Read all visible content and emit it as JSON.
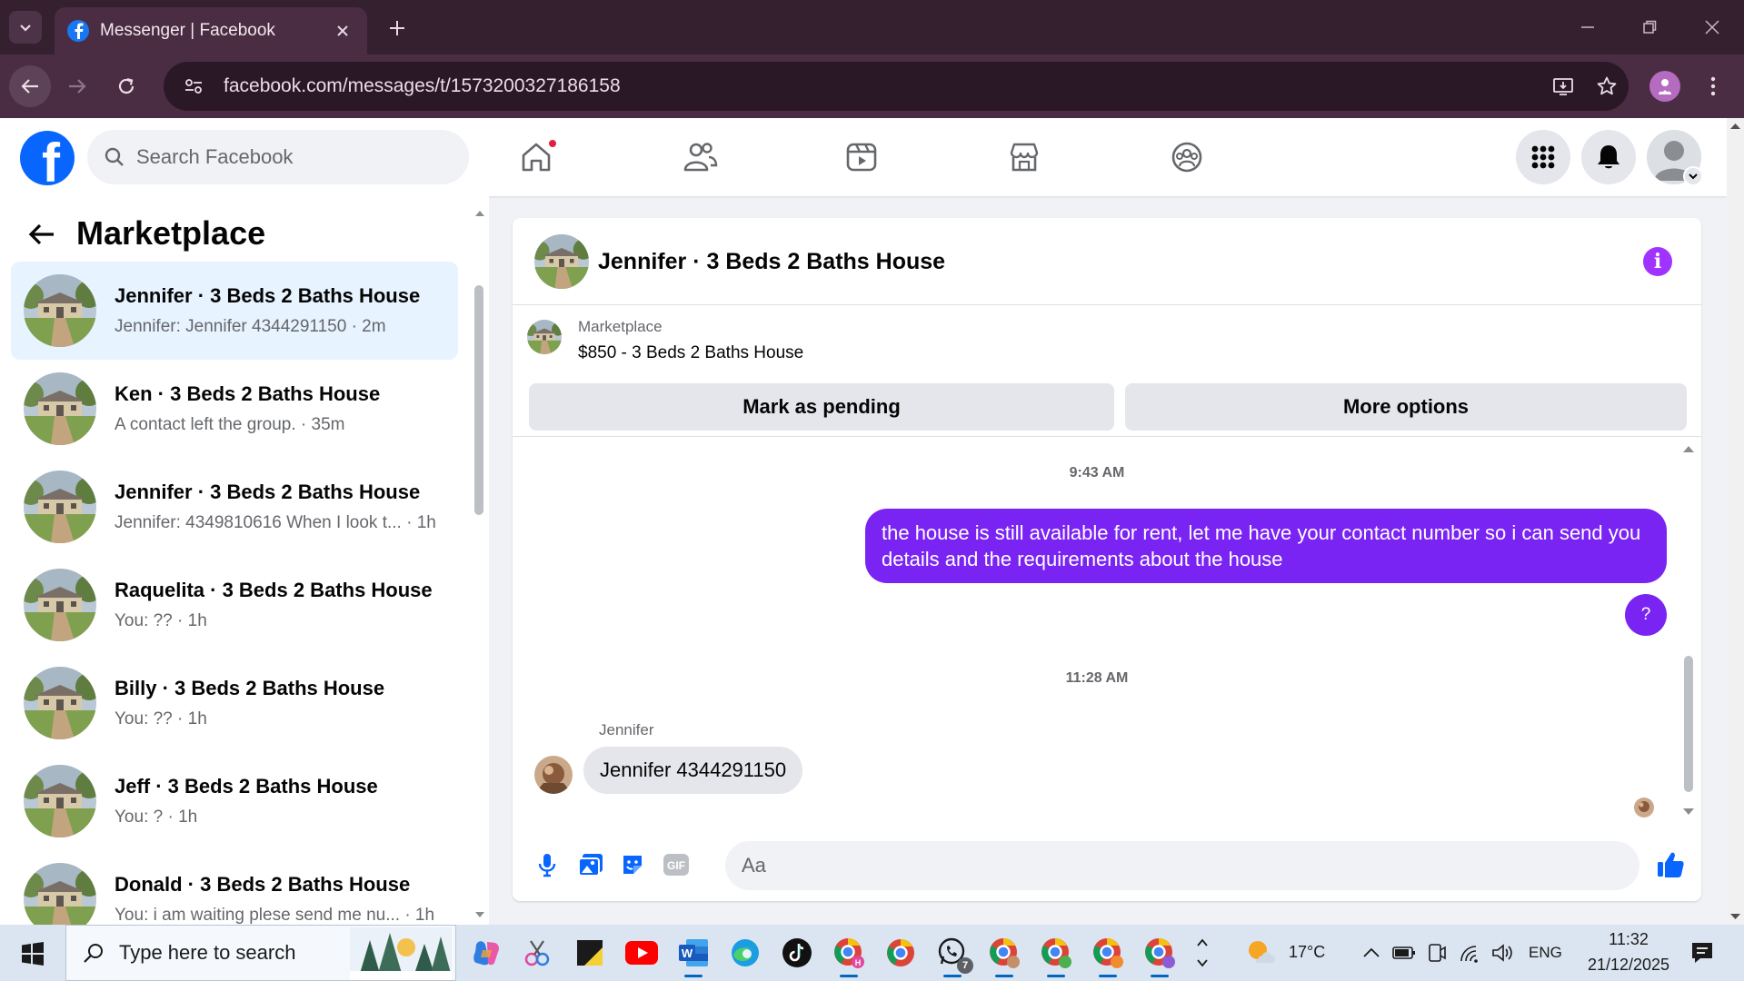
{
  "browser": {
    "tab_title": "Messenger | Facebook",
    "url": "facebook.com/messages/t/1573200327186158"
  },
  "facebook": {
    "search_placeholder": "Search Facebook",
    "nav_icons": [
      "home-icon",
      "friends-icon",
      "video-icon",
      "marketplace-icon",
      "groups-icon"
    ],
    "accent_color": "#0866ff"
  },
  "left_panel": {
    "title": "Marketplace",
    "conversations": [
      {
        "name": "Jennifer · 3 Beds 2 Baths House",
        "preview": "Jennifer: Jennifer 4344291150 · 2m",
        "active": true
      },
      {
        "name": "Ken · 3 Beds 2 Baths House",
        "preview": "A contact left the group. · 35m"
      },
      {
        "name": "Jennifer · 3 Beds 2 Baths House",
        "preview": "Jennifer: 4349810616 When I look t... · 1h"
      },
      {
        "name": "Raquelita · 3 Beds 2 Baths House",
        "preview": "You: ?? · 1h"
      },
      {
        "name": "Billy · 3 Beds 2 Baths House",
        "preview": "You: ?? · 1h"
      },
      {
        "name": "Jeff · 3 Beds 2 Baths House",
        "preview": "You: ? · 1h"
      },
      {
        "name": "Donald · 3 Beds 2 Baths House",
        "preview": "You: i am waiting plese send me nu... · 1h"
      }
    ]
  },
  "chat": {
    "title": "Jennifer · 3 Beds 2 Baths House",
    "info_glyph": "i",
    "listing": {
      "source": "Marketplace",
      "title": "$850 - 3 Beds 2 Baths House",
      "mark_pending_label": "Mark as pending",
      "more_options_label": "More options"
    },
    "messages": {
      "time_1": "9:43 AM",
      "outgoing_text": "the house is still available for rent, let me have your contact number so i can send you details and the requirements about the house",
      "outgoing_2": "?",
      "time_2": "11:28 AM",
      "sender": "Jennifer",
      "incoming_text": "Jennifer 4344291150"
    },
    "composer_placeholder": "Aa",
    "accent_color": "#7a24f4"
  },
  "taskbar": {
    "search_placeholder": "Type here to search",
    "temperature": "17°C",
    "language": "ENG",
    "time": "11:32",
    "date": "21/12/2025",
    "whatsapp_badge": "7"
  }
}
